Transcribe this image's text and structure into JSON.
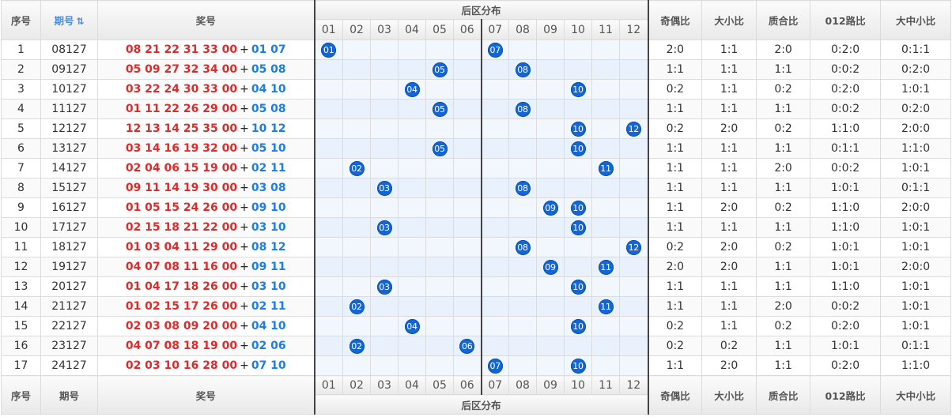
{
  "headers": {
    "index": "序号",
    "period": "期号",
    "draw": "奖号",
    "back_zone": "后区分布",
    "parity": "奇偶比",
    "size": "大小比",
    "prime": "质合比",
    "road012": "012路比",
    "sml": "大中小比",
    "sort_icon": "sort-icon"
  },
  "footer": {
    "index": "序号",
    "period": "期号",
    "draw": "奖号",
    "back_zone": "后区分布",
    "parity": "奇偶比",
    "size": "大小比",
    "prime": "质合比",
    "road012": "012路比",
    "sml": "大中小比"
  },
  "back_numbers": [
    "01",
    "02",
    "03",
    "04",
    "05",
    "06",
    "07",
    "08",
    "09",
    "10",
    "11",
    "12"
  ],
  "plus_sign": "+",
  "rows": [
    {
      "idx": "1",
      "period": "08127",
      "front": "08 21 22 31 33 00",
      "back": "01 07",
      "balls": [
        "01",
        "07"
      ],
      "parity": "2:0",
      "size": "1:1",
      "prime": "2:0",
      "road": "0:2:0",
      "sml": "0:1:1"
    },
    {
      "idx": "2",
      "period": "09127",
      "front": "05 09 27 32 34 00",
      "back": "05 08",
      "balls": [
        "05",
        "08"
      ],
      "parity": "1:1",
      "size": "1:1",
      "prime": "1:1",
      "road": "0:0:2",
      "sml": "0:2:0"
    },
    {
      "idx": "3",
      "period": "10127",
      "front": "03 22 24 30 33 00",
      "back": "04 10",
      "balls": [
        "04",
        "10"
      ],
      "parity": "0:2",
      "size": "1:1",
      "prime": "0:2",
      "road": "0:2:0",
      "sml": "1:0:1"
    },
    {
      "idx": "4",
      "period": "11127",
      "front": "01 11 22 26 29 00",
      "back": "05 08",
      "balls": [
        "05",
        "08"
      ],
      "parity": "1:1",
      "size": "1:1",
      "prime": "1:1",
      "road": "0:0:2",
      "sml": "0:2:0"
    },
    {
      "idx": "5",
      "period": "12127",
      "front": "12 13 14 25 35 00",
      "back": "10 12",
      "balls": [
        "10",
        "12"
      ],
      "parity": "0:2",
      "size": "2:0",
      "prime": "0:2",
      "road": "1:1:0",
      "sml": "2:0:0"
    },
    {
      "idx": "6",
      "period": "13127",
      "front": "03 14 16 19 32 00",
      "back": "05 10",
      "balls": [
        "05",
        "10"
      ],
      "parity": "1:1",
      "size": "1:1",
      "prime": "1:1",
      "road": "0:1:1",
      "sml": "1:1:0"
    },
    {
      "idx": "7",
      "period": "14127",
      "front": "02 04 06 15 19 00",
      "back": "02 11",
      "balls": [
        "02",
        "11"
      ],
      "parity": "1:1",
      "size": "1:1",
      "prime": "2:0",
      "road": "0:0:2",
      "sml": "1:0:1"
    },
    {
      "idx": "8",
      "period": "15127",
      "front": "09 11 14 19 30 00",
      "back": "03 08",
      "balls": [
        "03",
        "08"
      ],
      "parity": "1:1",
      "size": "1:1",
      "prime": "1:1",
      "road": "1:0:1",
      "sml": "0:1:1"
    },
    {
      "idx": "9",
      "period": "16127",
      "front": "01 05 15 24 26 00",
      "back": "09 10",
      "balls": [
        "09",
        "10"
      ],
      "parity": "1:1",
      "size": "2:0",
      "prime": "0:2",
      "road": "1:1:0",
      "sml": "2:0:0"
    },
    {
      "idx": "10",
      "period": "17127",
      "front": "02 15 18 21 22 00",
      "back": "03 10",
      "balls": [
        "03",
        "10"
      ],
      "parity": "1:1",
      "size": "1:1",
      "prime": "1:1",
      "road": "1:1:0",
      "sml": "1:0:1"
    },
    {
      "idx": "11",
      "period": "18127",
      "front": "01 03 04 11 29 00",
      "back": "08 12",
      "balls": [
        "08",
        "12"
      ],
      "parity": "0:2",
      "size": "2:0",
      "prime": "0:2",
      "road": "1:0:1",
      "sml": "1:0:1"
    },
    {
      "idx": "12",
      "period": "19127",
      "front": "04 07 08 11 16 00",
      "back": "09 11",
      "balls": [
        "09",
        "11"
      ],
      "parity": "2:0",
      "size": "2:0",
      "prime": "1:1",
      "road": "1:0:1",
      "sml": "2:0:0"
    },
    {
      "idx": "13",
      "period": "20127",
      "front": "01 04 17 18 26 00",
      "back": "03 10",
      "balls": [
        "03",
        "10"
      ],
      "parity": "1:1",
      "size": "1:1",
      "prime": "1:1",
      "road": "1:1:0",
      "sml": "1:0:1"
    },
    {
      "idx": "14",
      "period": "21127",
      "front": "01 02 15 17 26 00",
      "back": "02 11",
      "balls": [
        "02",
        "11"
      ],
      "parity": "1:1",
      "size": "1:1",
      "prime": "2:0",
      "road": "0:0:2",
      "sml": "1:0:1"
    },
    {
      "idx": "15",
      "period": "22127",
      "front": "02 03 08 09 20 00",
      "back": "04 10",
      "balls": [
        "04",
        "10"
      ],
      "parity": "0:2",
      "size": "1:1",
      "prime": "0:2",
      "road": "0:2:0",
      "sml": "1:0:1"
    },
    {
      "idx": "16",
      "period": "23127",
      "front": "04 07 08 18 19 00",
      "back": "02 06",
      "balls": [
        "02",
        "06"
      ],
      "parity": "0:2",
      "size": "0:2",
      "prime": "1:1",
      "road": "1:0:1",
      "sml": "0:1:1"
    },
    {
      "idx": "17",
      "period": "24127",
      "front": "02 03 10 16 28 00",
      "back": "07 10",
      "balls": [
        "07",
        "10"
      ],
      "parity": "1:1",
      "size": "2:0",
      "prime": "1:1",
      "road": "0:2:0",
      "sml": "1:1:0"
    }
  ]
}
